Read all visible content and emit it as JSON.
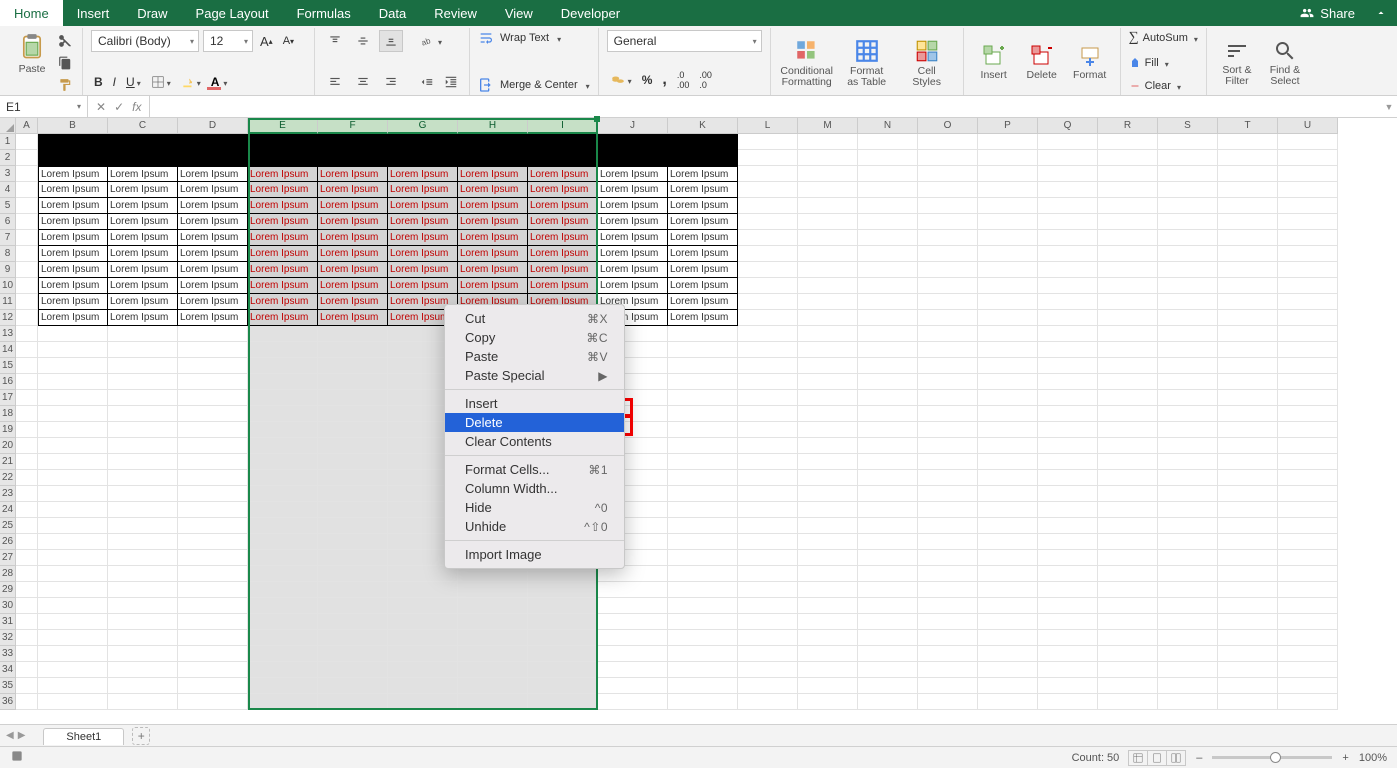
{
  "tabs": {
    "items": [
      "Home",
      "Insert",
      "Draw",
      "Page Layout",
      "Formulas",
      "Data",
      "Review",
      "View",
      "Developer"
    ],
    "active": "Home",
    "share": "Share"
  },
  "ribbon": {
    "paste": "Paste",
    "font_name": "Calibri (Body)",
    "font_size": "12",
    "wrap": "Wrap Text",
    "merge": "Merge & Center",
    "number_format": "General",
    "cond": "Conditional",
    "cond2": "Formatting",
    "table1": "Format",
    "table2": "as Table",
    "styles1": "Cell",
    "styles2": "Styles",
    "insert": "Insert",
    "delete": "Delete",
    "format": "Format",
    "autosum": "AutoSum",
    "fill": "Fill",
    "clear": "Clear",
    "sort1": "Sort &",
    "sort2": "Filter",
    "find1": "Find &",
    "find2": "Select"
  },
  "fx": {
    "name": "E1",
    "fx": "fx",
    "value": ""
  },
  "grid": {
    "colwidths": {
      "A": 22,
      "def": 70,
      "rest": 60
    },
    "columns": [
      "A",
      "B",
      "C",
      "D",
      "E",
      "F",
      "G",
      "H",
      "I",
      "J",
      "K",
      "L",
      "M",
      "N",
      "O",
      "P",
      "Q",
      "R",
      "S",
      "T",
      "U"
    ],
    "selected_cols": [
      "E",
      "F",
      "G",
      "H",
      "I"
    ],
    "rows": 36,
    "cell_text": "Lorem Ipsum",
    "data_cols": [
      "B",
      "C",
      "D",
      "E",
      "F",
      "G",
      "H",
      "I",
      "J",
      "K"
    ],
    "data_rows": [
      3,
      4,
      5,
      6,
      7,
      8,
      9,
      10,
      11,
      12
    ]
  },
  "ctx": {
    "items": [
      {
        "label": "Cut",
        "key": "⌘X"
      },
      {
        "label": "Copy",
        "key": "⌘C"
      },
      {
        "label": "Paste",
        "key": "⌘V"
      },
      {
        "label": "Paste Special",
        "sub": true
      },
      {
        "sep": true
      },
      {
        "label": "Insert"
      },
      {
        "label": "Delete",
        "hl": true
      },
      {
        "label": "Clear Contents"
      },
      {
        "sep": true
      },
      {
        "label": "Format Cells...",
        "key": "⌘1"
      },
      {
        "label": "Column Width..."
      },
      {
        "label": "Hide",
        "key": "^0"
      },
      {
        "label": "Unhide",
        "key": "^⇧0"
      },
      {
        "sep": true
      },
      {
        "label": "Import Image"
      }
    ]
  },
  "sheets": {
    "active": "Sheet1"
  },
  "status": {
    "count": "Count: 50",
    "zoom": "100%",
    "plus": "+",
    "minus": "–"
  }
}
